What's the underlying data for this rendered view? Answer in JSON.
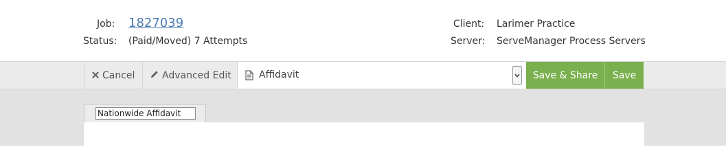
{
  "info": {
    "job_label": "Job:",
    "job_number": "1827039",
    "status_label": "Status:",
    "status_value": "(Paid/Moved) 7 Attempts",
    "client_label": "Client:",
    "client_value": "Larimer Practice",
    "server_label": "Server:",
    "server_value": "ServeManager Process Servers"
  },
  "toolbar": {
    "cancel_label": "Cancel",
    "advanced_edit_label": "Advanced Edit",
    "template_selected": "Affidavit",
    "save_share_label": "Save & Share",
    "save_label": "Save"
  },
  "editor": {
    "document_name": "Nationwide Affidavit"
  },
  "colors": {
    "link": "#4a7ab0",
    "primary_button": "#7ab04d",
    "toolbar_bg": "#ebebeb",
    "workspace_bg": "#e2e2e2"
  },
  "icons": [
    "times-icon",
    "pencil-icon",
    "document-icon",
    "chevron-down-icon"
  ]
}
